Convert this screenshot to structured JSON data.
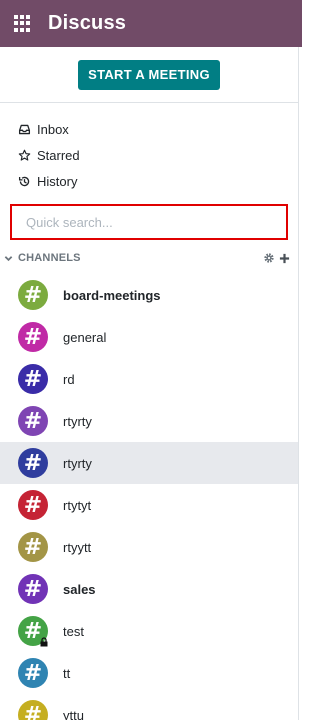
{
  "header": {
    "title": "Discuss"
  },
  "actions": {
    "start_meeting": "START A MEETING"
  },
  "nav": [
    {
      "label": "Inbox",
      "icon": "inbox-icon"
    },
    {
      "label": "Starred",
      "icon": "star-icon"
    },
    {
      "label": "History",
      "icon": "history-icon"
    }
  ],
  "search": {
    "placeholder": "Quick search..."
  },
  "channels": {
    "title": "CHANNELS",
    "items": [
      {
        "name": "board-meetings",
        "bold": true,
        "color": "#7cab3f"
      },
      {
        "name": "general",
        "bold": false,
        "color": "#c02aa6"
      },
      {
        "name": "rd",
        "bold": false,
        "color": "#3a2ca8"
      },
      {
        "name": "rtyrty",
        "bold": false,
        "color": "#7f45b3"
      },
      {
        "name": "rtyrty",
        "bold": false,
        "color": "#2f3d9e",
        "active": true
      },
      {
        "name": "rtytyt",
        "bold": false,
        "color": "#c52435"
      },
      {
        "name": "rtyytt",
        "bold": false,
        "color": "#a39546"
      },
      {
        "name": "sales",
        "bold": true,
        "color": "#7133b6"
      },
      {
        "name": "test",
        "bold": false,
        "color": "#44a346",
        "locked": true
      },
      {
        "name": "tt",
        "bold": false,
        "color": "#2f84b2"
      },
      {
        "name": "yttu",
        "bold": false,
        "color": "#c5ae21"
      }
    ]
  },
  "colors": {
    "brand": "#714b67",
    "accent": "#017e84",
    "search_border": "#e00000"
  }
}
